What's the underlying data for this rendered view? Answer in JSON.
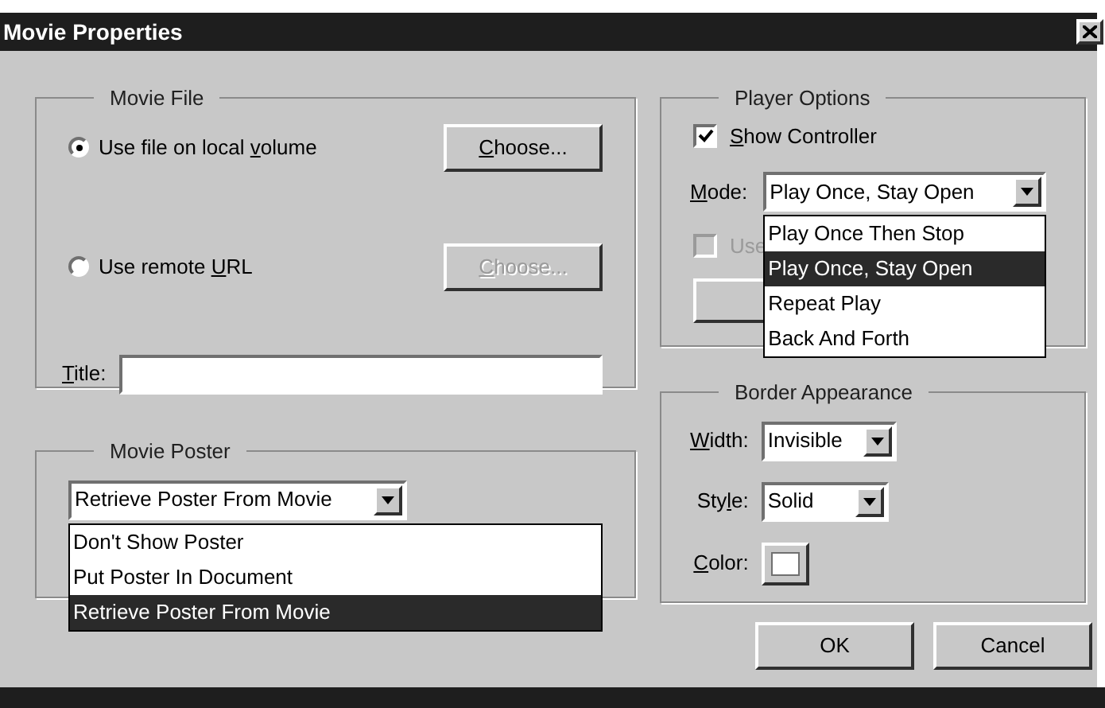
{
  "window": {
    "title": "Movie Properties"
  },
  "movie_file": {
    "legend": "Movie File",
    "sources": [
      {
        "label": {
          "pre": "Use file on local ",
          "key": "v",
          "post": "olume"
        },
        "selected": true,
        "button": {
          "label": {
            "key": "C",
            "post": "hoose..."
          },
          "disabled": false
        }
      },
      {
        "label": {
          "pre": "Use remote ",
          "key": "U",
          "post": "RL"
        },
        "selected": false,
        "button": {
          "label": {
            "key": "C",
            "post": "hoose..."
          },
          "disabled": true
        }
      }
    ],
    "title_field": {
      "label": {
        "key": "T",
        "post": "itle:"
      }
    }
  },
  "movie_poster": {
    "legend": "Movie Poster",
    "dropdown": {
      "value": "Retrieve Poster From Movie",
      "options": [
        {
          "label": "Don't Show Poster",
          "selected": false
        },
        {
          "label": "Put Poster In Document",
          "selected": false
        },
        {
          "label": "Retrieve Poster From Movie",
          "selected": true
        }
      ]
    }
  },
  "player_options": {
    "legend": "Player Options",
    "show_controller": {
      "label": {
        "key": "S",
        "post": "how Controller"
      },
      "checked": true,
      "disabled": false
    },
    "mode": {
      "label": {
        "key": "M",
        "post": "ode:"
      },
      "dropdown": {
        "value": "Play Once, Stay Open",
        "options": [
          {
            "label": "Play Once Then Stop",
            "selected": false
          },
          {
            "label": "Play Once, Stay Open",
            "selected": true
          },
          {
            "label": "Repeat Play",
            "selected": false
          },
          {
            "label": "Back And Forth",
            "selected": false
          }
        ]
      }
    },
    "use_option": {
      "label": {
        "post": "Use"
      },
      "checked": false,
      "disabled": true
    }
  },
  "border_appearance": {
    "legend": "Border Appearance",
    "width": {
      "label": {
        "key": "W",
        "post": "idth:"
      },
      "dropdown": {
        "value": "Invisible"
      }
    },
    "style": {
      "label": {
        "pre": "Sty",
        "key": "l",
        "post": "e:"
      },
      "dropdown": {
        "value": "Solid"
      }
    },
    "color": {
      "label": {
        "key": "C",
        "post": "olor:"
      }
    }
  },
  "buttons": [
    {
      "label": "OK"
    },
    {
      "label": "Cancel"
    }
  ]
}
